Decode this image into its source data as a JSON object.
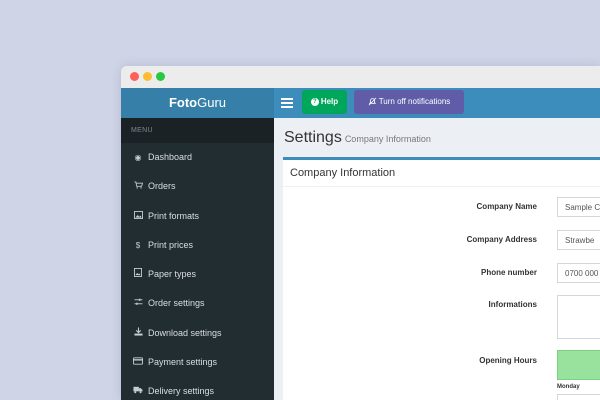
{
  "app": {
    "logo_bold": "Foto",
    "logo_regular": "Guru"
  },
  "topbar": {
    "help_label": "Help",
    "notifications_label": "Turn off notifications"
  },
  "sidebar": {
    "header": "MENU",
    "items": [
      {
        "label": "Dashboard",
        "icon": "dashboard-icon"
      },
      {
        "label": "Orders",
        "icon": "cart-icon"
      },
      {
        "label": "Print formats",
        "icon": "image-icon"
      },
      {
        "label": "Print prices",
        "icon": "dollar-icon"
      },
      {
        "label": "Paper types",
        "icon": "paper-icon"
      },
      {
        "label": "Order settings",
        "icon": "sliders-icon"
      },
      {
        "label": "Download settings",
        "icon": "download-icon"
      },
      {
        "label": "Payment settings",
        "icon": "credit-card-icon"
      },
      {
        "label": "Delivery settings",
        "icon": "truck-icon"
      }
    ]
  },
  "page": {
    "title": "Settings",
    "subtitle": "Company Information"
  },
  "form": {
    "box_title": "Company Information",
    "company_name_label": "Company Name",
    "company_name_value": "Sample C",
    "company_address_label": "Company Address",
    "company_address_value": "Strawbe",
    "phone_label": "Phone number",
    "phone_value": "0700 000",
    "informations_label": "Informations",
    "opening_hours_label": "Opening Hours",
    "day_label": "Monday"
  },
  "colors": {
    "topbar": "#3c8dbc",
    "sidebar": "#222d32",
    "help_button": "#00a65a",
    "notifications_button": "#605ca8",
    "hours_open": "#98e29e"
  }
}
